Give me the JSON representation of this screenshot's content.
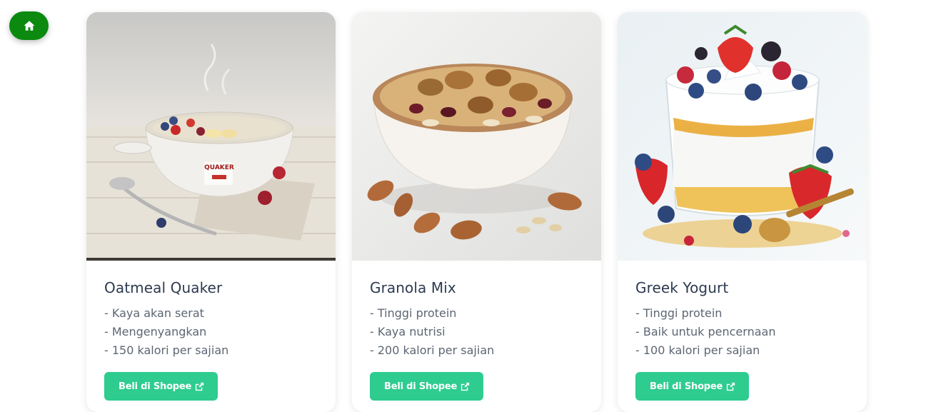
{
  "home": {
    "icon": "home-icon",
    "color": "#0b8a0f"
  },
  "products": [
    {
      "image_icon": "oatmeal-bowl-image",
      "title": "Oatmeal Quaker",
      "features": [
        "- Kaya akan serat",
        "- Mengenyangkan",
        "- 150 kalori per sajian"
      ],
      "button_label": "Beli di Shopee",
      "brand_label": "QUAKER"
    },
    {
      "image_icon": "granola-bowl-image",
      "title": "Granola Mix",
      "features": [
        "- Tinggi protein",
        "- Kaya nutrisi",
        "- 200 kalori per sajian"
      ],
      "button_label": "Beli di Shopee"
    },
    {
      "image_icon": "greek-yogurt-image",
      "title": "Greek Yogurt",
      "features": [
        "- Tinggi protein",
        "- Baik untuk pencernaan",
        "- 100 kalori per sajian"
      ],
      "button_label": "Beli di Shopee"
    }
  ],
  "colors": {
    "button": "#2ecc8f",
    "title": "#2c3a4f",
    "text": "#5d6673"
  }
}
